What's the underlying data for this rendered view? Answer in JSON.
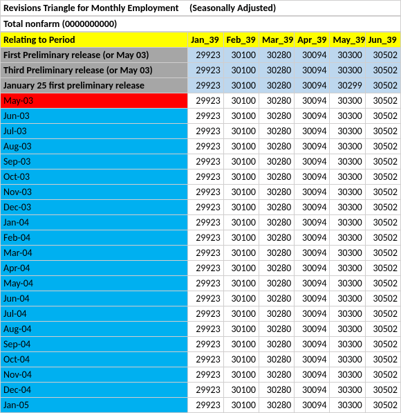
{
  "title_left": "Revisions Triangle for Monthly Employment",
  "title_right": "(Seasonally Adjusted)",
  "subtitle": "Total nonfarm (0000000000)",
  "header_label": "Relating to Period",
  "columns": [
    "Jan_39",
    "Feb_39",
    "Mar_39",
    "Apr_39",
    "May_39",
    "Jun_39"
  ],
  "prelim": [
    {
      "label": "First Preliminary release (or May 03)",
      "vals": [
        29923,
        30100,
        30280,
        30094,
        30300,
        30502
      ]
    },
    {
      "label": "Third Preliminary release (or May 03)",
      "vals": [
        29923,
        30100,
        30280,
        30094,
        30300,
        30502
      ]
    },
    {
      "label": "January 25 first preliminary release",
      "vals": [
        29923,
        30100,
        30280,
        30094,
        30299,
        30502
      ]
    }
  ],
  "body": [
    {
      "label": "May-03",
      "red": true,
      "vals": [
        29923,
        30100,
        30280,
        30094,
        30300,
        30502
      ]
    },
    {
      "label": "Jun-03",
      "red": false,
      "vals": [
        29923,
        30100,
        30280,
        30094,
        30300,
        30502
      ]
    },
    {
      "label": "Jul-03",
      "red": false,
      "vals": [
        29923,
        30100,
        30280,
        30094,
        30300,
        30502
      ]
    },
    {
      "label": "Aug-03",
      "red": false,
      "vals": [
        29923,
        30100,
        30280,
        30094,
        30300,
        30502
      ]
    },
    {
      "label": "Sep-03",
      "red": false,
      "vals": [
        29923,
        30100,
        30280,
        30094,
        30300,
        30502
      ]
    },
    {
      "label": "Oct-03",
      "red": false,
      "vals": [
        29923,
        30100,
        30280,
        30094,
        30300,
        30502
      ]
    },
    {
      "label": "Nov-03",
      "red": false,
      "vals": [
        29923,
        30100,
        30280,
        30094,
        30300,
        30502
      ]
    },
    {
      "label": "Dec-03",
      "red": false,
      "vals": [
        29923,
        30100,
        30280,
        30094,
        30300,
        30502
      ]
    },
    {
      "label": "Jan-04",
      "red": false,
      "vals": [
        29923,
        30100,
        30280,
        30094,
        30300,
        30502
      ]
    },
    {
      "label": "Feb-04",
      "red": false,
      "vals": [
        29923,
        30100,
        30280,
        30094,
        30300,
        30502
      ]
    },
    {
      "label": "Mar-04",
      "red": false,
      "vals": [
        29923,
        30100,
        30280,
        30094,
        30300,
        30502
      ]
    },
    {
      "label": "Apr-04",
      "red": false,
      "vals": [
        29923,
        30100,
        30280,
        30094,
        30300,
        30502
      ]
    },
    {
      "label": "May-04",
      "red": false,
      "vals": [
        29923,
        30100,
        30280,
        30094,
        30300,
        30502
      ]
    },
    {
      "label": "Jun-04",
      "red": false,
      "vals": [
        29923,
        30100,
        30280,
        30094,
        30300,
        30502
      ]
    },
    {
      "label": "Jul-04",
      "red": false,
      "vals": [
        29923,
        30100,
        30280,
        30094,
        30300,
        30502
      ]
    },
    {
      "label": "Aug-04",
      "red": false,
      "vals": [
        29923,
        30100,
        30280,
        30094,
        30300,
        30502
      ]
    },
    {
      "label": "Sep-04",
      "red": false,
      "vals": [
        29923,
        30100,
        30280,
        30094,
        30300,
        30502
      ]
    },
    {
      "label": "Oct-04",
      "red": false,
      "vals": [
        29923,
        30100,
        30280,
        30094,
        30300,
        30502
      ]
    },
    {
      "label": "Nov-04",
      "red": false,
      "vals": [
        29923,
        30100,
        30280,
        30094,
        30300,
        30502
      ]
    },
    {
      "label": "Dec-04",
      "red": false,
      "vals": [
        29923,
        30100,
        30280,
        30094,
        30300,
        30502
      ]
    },
    {
      "label": "Jan-05",
      "red": false,
      "vals": [
        29923,
        30100,
        30280,
        30094,
        30300,
        30502
      ]
    }
  ],
  "chart_data": {
    "type": "table",
    "title": "Revisions Triangle for Monthly Employment (Seasonally Adjusted) — Total nonfarm",
    "columns": [
      "Jan_39",
      "Feb_39",
      "Mar_39",
      "Apr_39",
      "May_39",
      "Jun_39"
    ],
    "row_labels": [
      "First Preliminary release (or May 03)",
      "Third Preliminary release (or May 03)",
      "January 25 first preliminary release",
      "May-03",
      "Jun-03",
      "Jul-03",
      "Aug-03",
      "Sep-03",
      "Oct-03",
      "Nov-03",
      "Dec-03",
      "Jan-04",
      "Feb-04",
      "Mar-04",
      "Apr-04",
      "May-04",
      "Jun-04",
      "Jul-04",
      "Aug-04",
      "Sep-04",
      "Oct-04",
      "Nov-04",
      "Dec-04",
      "Jan-05"
    ],
    "values": [
      [
        29923,
        30100,
        30280,
        30094,
        30300,
        30502
      ],
      [
        29923,
        30100,
        30280,
        30094,
        30300,
        30502
      ],
      [
        29923,
        30100,
        30280,
        30094,
        30299,
        30502
      ],
      [
        29923,
        30100,
        30280,
        30094,
        30300,
        30502
      ],
      [
        29923,
        30100,
        30280,
        30094,
        30300,
        30502
      ],
      [
        29923,
        30100,
        30280,
        30094,
        30300,
        30502
      ],
      [
        29923,
        30100,
        30280,
        30094,
        30300,
        30502
      ],
      [
        29923,
        30100,
        30280,
        30094,
        30300,
        30502
      ],
      [
        29923,
        30100,
        30280,
        30094,
        30300,
        30502
      ],
      [
        29923,
        30100,
        30280,
        30094,
        30300,
        30502
      ],
      [
        29923,
        30100,
        30280,
        30094,
        30300,
        30502
      ],
      [
        29923,
        30100,
        30280,
        30094,
        30300,
        30502
      ],
      [
        29923,
        30100,
        30280,
        30094,
        30300,
        30502
      ],
      [
        29923,
        30100,
        30280,
        30094,
        30300,
        30502
      ],
      [
        29923,
        30100,
        30280,
        30094,
        30300,
        30502
      ],
      [
        29923,
        30100,
        30280,
        30094,
        30300,
        30502
      ],
      [
        29923,
        30100,
        30280,
        30094,
        30300,
        30502
      ],
      [
        29923,
        30100,
        30280,
        30094,
        30300,
        30502
      ],
      [
        29923,
        30100,
        30280,
        30094,
        30300,
        30502
      ],
      [
        29923,
        30100,
        30280,
        30094,
        30300,
        30502
      ],
      [
        29923,
        30100,
        30280,
        30094,
        30300,
        30502
      ],
      [
        29923,
        30100,
        30280,
        30094,
        30300,
        30502
      ],
      [
        29923,
        30100,
        30280,
        30094,
        30300,
        30502
      ],
      [
        29923,
        30100,
        30280,
        30094,
        30300,
        30502
      ]
    ]
  }
}
